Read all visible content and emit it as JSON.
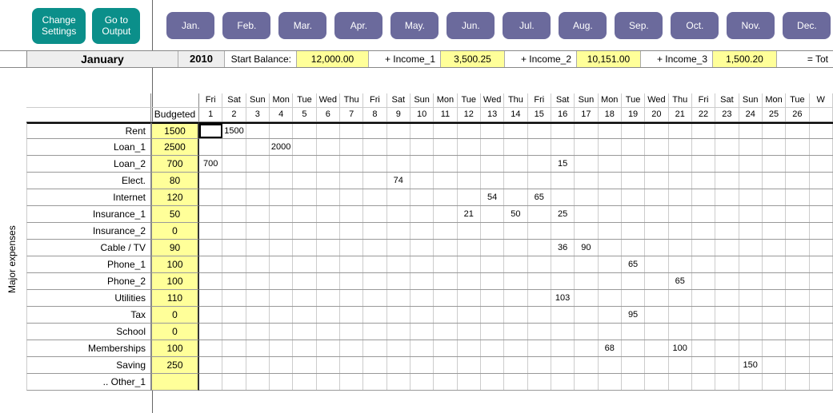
{
  "buttons": {
    "change_settings": "Change\nSettings",
    "goto_output": "Go to\nOutput"
  },
  "months": [
    "Jan.",
    "Feb.",
    "Mar.",
    "Apr.",
    "May.",
    "Jun.",
    "Jul.",
    "Aug.",
    "Sep.",
    "Oct.",
    "Nov.",
    "Dec."
  ],
  "summary": {
    "month": "January",
    "year": "2010",
    "start_balance_label": "Start Balance:",
    "start_balance": "12,000.00",
    "income1_label": "+ Income_1",
    "income1": "3,500.25",
    "income2_label": "+ Income_2",
    "income2": "10,151.00",
    "income3_label": "+ Income_3",
    "income3": "1,500.20",
    "total_label": "= Tot"
  },
  "side_title": "Major expenses",
  "budget_header": "Budgeted",
  "day_names": [
    "Fri",
    "Sat",
    "Sun",
    "Mon",
    "Tue",
    "Wed",
    "Thu",
    "Fri",
    "Sat",
    "Sun",
    "Mon",
    "Tue",
    "Wed",
    "Thu",
    "Fri",
    "Sat",
    "Sun",
    "Mon",
    "Tue",
    "Wed",
    "Thu",
    "Fri",
    "Sat",
    "Sun",
    "Mon",
    "Tue",
    "W"
  ],
  "day_nums": [
    "1",
    "2",
    "3",
    "4",
    "5",
    "6",
    "7",
    "8",
    "9",
    "10",
    "11",
    "12",
    "13",
    "14",
    "15",
    "16",
    "17",
    "18",
    "19",
    "20",
    "21",
    "22",
    "23",
    "24",
    "25",
    "26",
    ""
  ],
  "rows": [
    {
      "label": "Rent",
      "budget": "1500",
      "cells": {
        "2": "1500"
      }
    },
    {
      "label": "Loan_1",
      "budget": "2500",
      "cells": {
        "4": "2000"
      }
    },
    {
      "label": "Loan_2",
      "budget": "700",
      "cells": {
        "1": "700",
        "16": "15"
      }
    },
    {
      "label": "Elect.",
      "budget": "80",
      "cells": {
        "9": "74"
      }
    },
    {
      "label": "Internet",
      "budget": "120",
      "cells": {
        "13": "54",
        "15": "65"
      }
    },
    {
      "label": "Insurance_1",
      "budget": "50",
      "cells": {
        "12": "21",
        "14": "50",
        "16": "25"
      }
    },
    {
      "label": "Insurance_2",
      "budget": "0",
      "cells": {}
    },
    {
      "label": "Cable / TV",
      "budget": "90",
      "cells": {
        "16": "36",
        "17": "90"
      }
    },
    {
      "label": "Phone_1",
      "budget": "100",
      "cells": {
        "19": "65"
      }
    },
    {
      "label": "Phone_2",
      "budget": "100",
      "cells": {
        "21": "65"
      }
    },
    {
      "label": "Utilities",
      "budget": "110",
      "cells": {
        "16": "103"
      }
    },
    {
      "label": "Tax",
      "budget": "0",
      "cells": {
        "19": "95"
      }
    },
    {
      "label": "School",
      "budget": "0",
      "cells": {}
    },
    {
      "label": "Memberships",
      "budget": "100",
      "cells": {
        "18": "68",
        "21": "100"
      }
    },
    {
      "label": "Saving",
      "budget": "250",
      "cells": {
        "24": "150"
      }
    },
    {
      "label": ".. Other_1",
      "budget": "",
      "cells": {}
    }
  ]
}
